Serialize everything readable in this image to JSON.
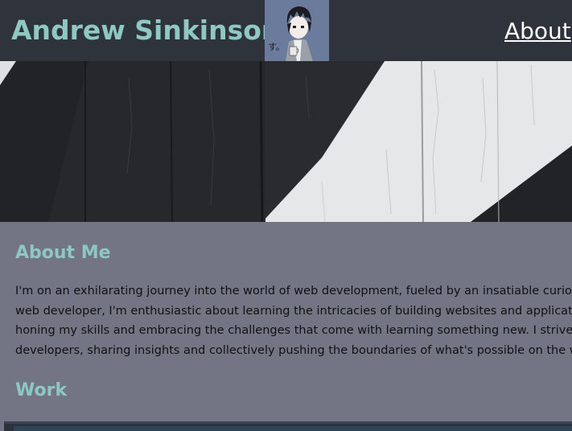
{
  "header": {
    "site_title": "Andrew Sinkinson",
    "nav_about": "About",
    "avatar_mark": "す。"
  },
  "about": {
    "heading": "About Me",
    "lines": [
      "I'm on an exhilarating journey into the world of web development, fueled by an insatiable curiosity",
      "web developer, I'm enthusiastic about learning the intricacies of building websites and applications",
      "honing my skills and embracing the challenges that come with learning something new. I strive to",
      "developers, sharing insights and collectively pushing the boundaries of what's possible on the web."
    ]
  },
  "work": {
    "heading": "Work"
  },
  "colors": {
    "header_bg": "#2f333c",
    "accent": "#8fc7c5",
    "content_bg": "#737585"
  },
  "icons": {
    "hero": "painted-wood-stripes-image",
    "avatar": "anime-avatar-image"
  }
}
